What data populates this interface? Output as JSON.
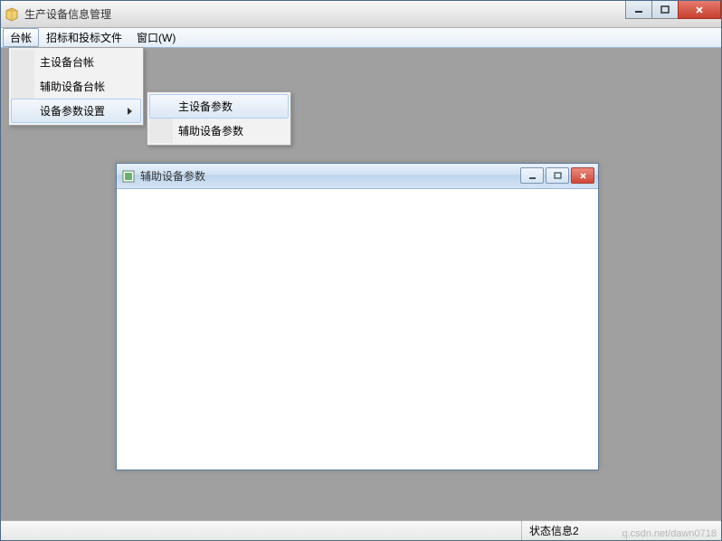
{
  "mainWindow": {
    "title": "生产设备信息管理"
  },
  "menubar": {
    "items": [
      {
        "label": "台帐",
        "active": true
      },
      {
        "label": "招标和投标文件",
        "active": false
      },
      {
        "label": "窗口(W)",
        "active": false
      }
    ]
  },
  "dropdown1": {
    "items": [
      {
        "label": "主设备台帐",
        "hasSubmenu": false,
        "highlighted": false
      },
      {
        "label": "辅助设备台帐",
        "hasSubmenu": false,
        "highlighted": false
      },
      {
        "label": "设备参数设置",
        "hasSubmenu": true,
        "highlighted": true
      }
    ]
  },
  "dropdown2": {
    "items": [
      {
        "label": "主设备参数",
        "highlighted": true
      },
      {
        "label": "辅助设备参数",
        "highlighted": false
      }
    ]
  },
  "childWindow": {
    "title": "辅助设备参数"
  },
  "statusbar": {
    "pane1": "",
    "pane2": "状态信息2"
  },
  "watermark": "q.csdn.net/dawn0718"
}
